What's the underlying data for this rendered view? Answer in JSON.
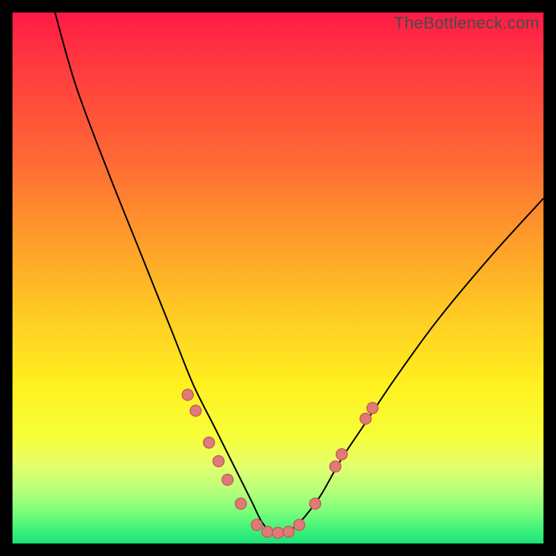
{
  "watermark": "TheBottleneck.com",
  "colors": {
    "background": "#000000",
    "gradient_top": "#ff1a47",
    "gradient_bottom": "#1ee07a",
    "curve": "#000000",
    "marker_fill": "#e07a78",
    "marker_stroke": "#c55a58"
  },
  "chart_data": {
    "type": "line",
    "title": "",
    "xlabel": "",
    "ylabel": "",
    "xlim": [
      0,
      100
    ],
    "ylim": [
      0,
      100
    ],
    "grid": false,
    "legend": false,
    "series": [
      {
        "name": "bottleneck-curve",
        "x": [
          8,
          12,
          18,
          24,
          30,
          34,
          38,
          42,
          45,
          47,
          49,
          51,
          53,
          55,
          58,
          62,
          66,
          72,
          80,
          90,
          100
        ],
        "values": [
          100,
          86,
          70,
          55,
          40,
          30,
          22,
          14,
          8,
          4,
          2,
          2,
          3,
          5,
          9,
          16,
          22,
          31,
          42,
          54,
          65
        ]
      }
    ],
    "markers": [
      {
        "x": 33.0,
        "y": 28.0
      },
      {
        "x": 34.5,
        "y": 25.0
      },
      {
        "x": 37.0,
        "y": 19.0
      },
      {
        "x": 38.8,
        "y": 15.5
      },
      {
        "x": 40.5,
        "y": 12.0
      },
      {
        "x": 43.0,
        "y": 7.5
      },
      {
        "x": 46.0,
        "y": 3.5
      },
      {
        "x": 48.0,
        "y": 2.2
      },
      {
        "x": 50.0,
        "y": 2.0
      },
      {
        "x": 52.0,
        "y": 2.2
      },
      {
        "x": 54.0,
        "y": 3.5
      },
      {
        "x": 57.0,
        "y": 7.5
      },
      {
        "x": 60.8,
        "y": 14.5
      },
      {
        "x": 62.0,
        "y": 16.8
      },
      {
        "x": 66.5,
        "y": 23.5
      },
      {
        "x": 67.8,
        "y": 25.5
      }
    ],
    "marker_radius": 8
  }
}
